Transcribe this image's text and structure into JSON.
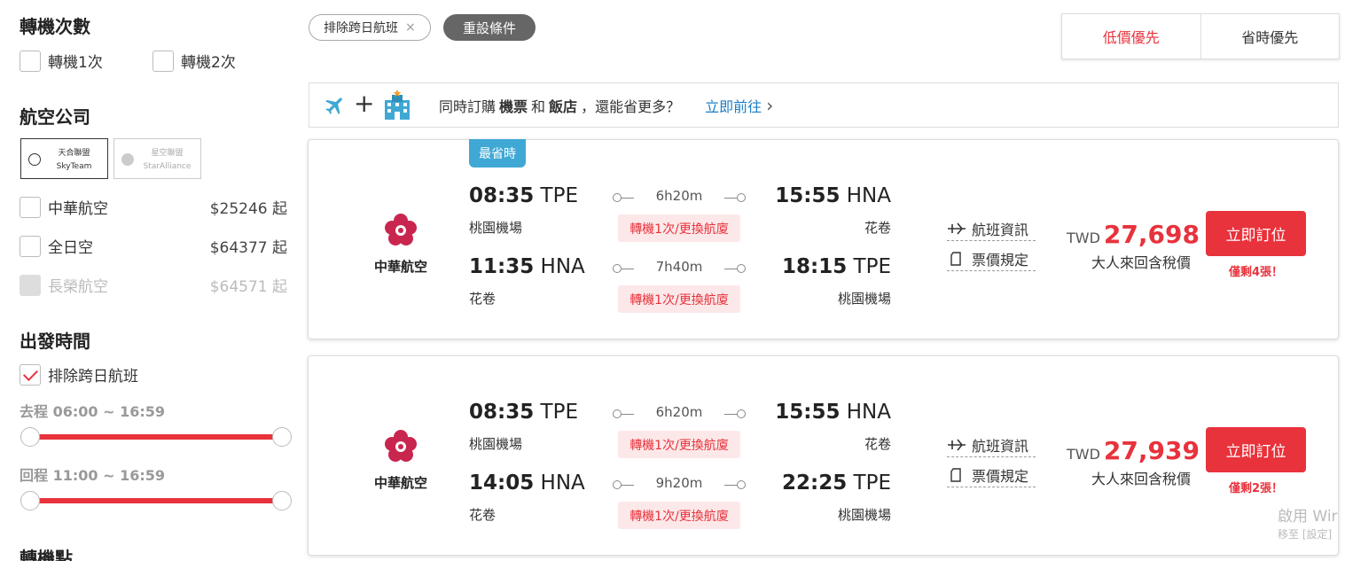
{
  "sidebar": {
    "transfer": {
      "title": "轉機次數",
      "options": [
        {
          "label": "轉機1次"
        },
        {
          "label": "轉機2次"
        }
      ]
    },
    "airline": {
      "title": "航空公司",
      "alliances": [
        {
          "name": "天合聯盟",
          "sub": "SkyTeam"
        },
        {
          "name": "星空聯盟",
          "sub": "StarAlliance"
        }
      ],
      "items": [
        {
          "label": "中華航空",
          "price": "$25246 起"
        },
        {
          "label": "全日空",
          "price": "$64377 起"
        },
        {
          "label": "長榮航空",
          "price": "$64571 起"
        }
      ]
    },
    "departure": {
      "title": "出發時間",
      "exclude_label": "排除跨日航班",
      "outbound_label": "去程",
      "outbound_range": "06:00 ~ 16:59",
      "return_label": "回程",
      "return_range": "11:00 ~ 16:59"
    },
    "transit_title": "轉機點"
  },
  "filters": {
    "chip_label": "排除跨日航班",
    "chip_close": "×",
    "reset_label": "重設條件"
  },
  "sort": {
    "options": [
      "低價優先",
      "省時優先"
    ]
  },
  "promo": {
    "plus": "+",
    "text_a": "同時訂購",
    "bold_a": "機票",
    "text_b": "和",
    "bold_b": "飯店",
    "text_c": "，還能省更多？",
    "link": "立即前往",
    "link_chevron": "›"
  },
  "colors": {
    "accent": "#e8323c",
    "badge": "#3fa8d4",
    "link": "#1a7ec6"
  },
  "flights": [
    {
      "badge": "最省時",
      "airline": "中華航空",
      "legs": [
        {
          "dep_time": "08:35",
          "dep_code": "TPE",
          "dep_airport": "桃園機場",
          "duration": "6h20m",
          "stop": "轉機1次/更換航廈",
          "arr_time": "15:55",
          "arr_code": "HNA",
          "arr_airport": "花卷"
        },
        {
          "dep_time": "11:35",
          "dep_code": "HNA",
          "dep_airport": "花卷",
          "duration": "7h40m",
          "stop": "轉機1次/更換航廈",
          "arr_time": "18:15",
          "arr_code": "TPE",
          "arr_airport": "桃園機場"
        }
      ],
      "flight_info": "航班資訊",
      "fare_rules": "票價規定",
      "currency": "TWD",
      "price": "27,698",
      "price_note": "大人來回含稅價",
      "book_label": "立即訂位",
      "remaining": "僅剩4張！"
    },
    {
      "airline": "中華航空",
      "legs": [
        {
          "dep_time": "08:35",
          "dep_code": "TPE",
          "dep_airport": "桃園機場",
          "duration": "6h20m",
          "stop": "轉機1次/更換航廈",
          "arr_time": "15:55",
          "arr_code": "HNA",
          "arr_airport": "花卷"
        },
        {
          "dep_time": "14:05",
          "dep_code": "HNA",
          "dep_airport": "花卷",
          "duration": "9h20m",
          "stop": "轉機1次/更換航廈",
          "arr_time": "22:25",
          "arr_code": "TPE",
          "arr_airport": "桃園機場"
        }
      ],
      "flight_info": "航班資訊",
      "fare_rules": "票價規定",
      "currency": "TWD",
      "price": "27,939",
      "price_note": "大人來回含稅價",
      "book_label": "立即訂位",
      "remaining": "僅剩2張！"
    }
  ],
  "watermark": {
    "line1": "啟用 Wir",
    "line2": "移至 [設定]"
  }
}
